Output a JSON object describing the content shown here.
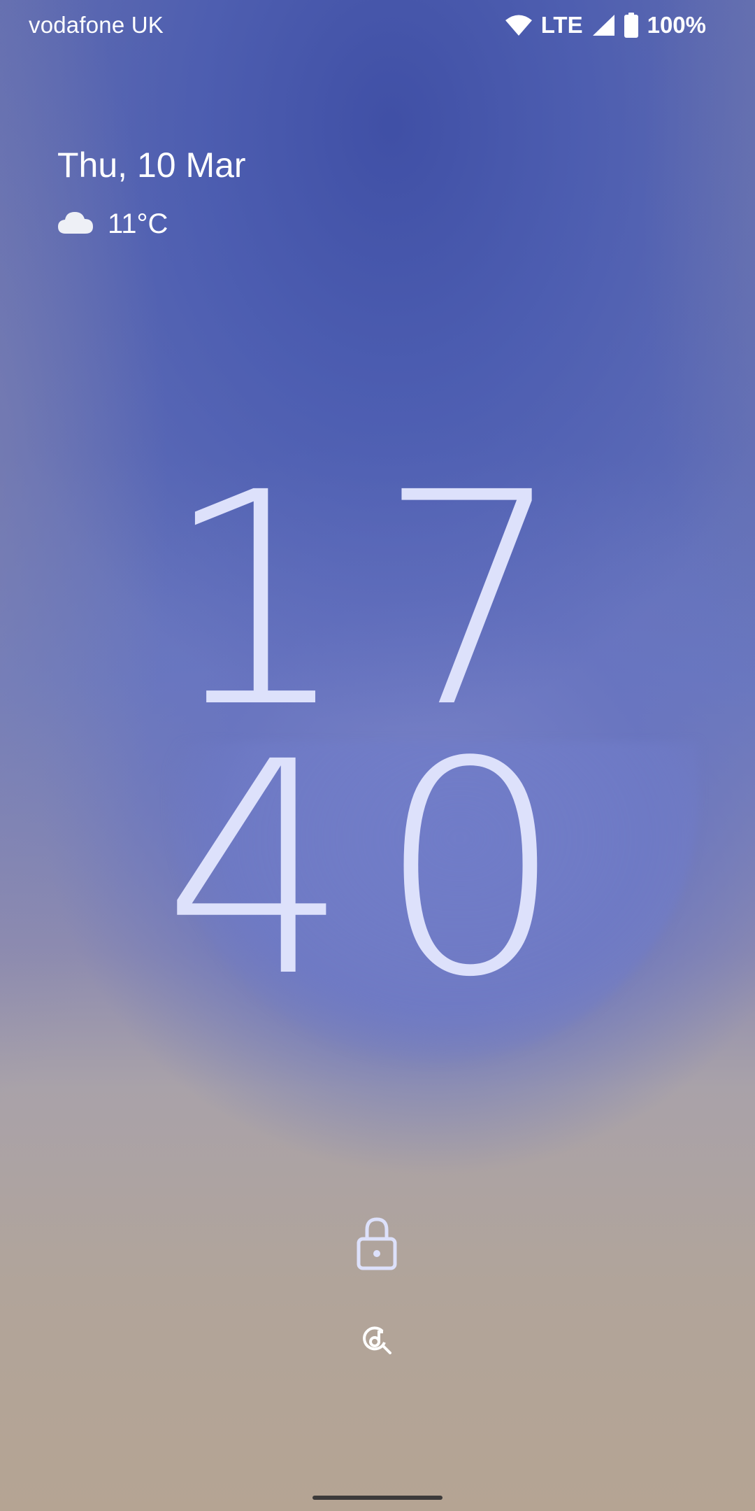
{
  "status_bar": {
    "carrier": "vodafone UK",
    "network_type": "LTE",
    "battery_percent": "100%",
    "icons": [
      "wifi-icon",
      "cell-signal-icon",
      "battery-icon"
    ]
  },
  "lockscreen": {
    "date": "Thu, 10 Mar",
    "weather": {
      "icon": "cloud-icon",
      "temperature": "11°C"
    },
    "clock": {
      "hours": "17",
      "minutes": "40"
    },
    "lock_icon": "lock-icon",
    "shortcut_icon": "now-playing-search-icon"
  },
  "colors": {
    "clock_text": "#dde1fb",
    "wallpaper_blue": "#5f6db8",
    "wallpaper_sand": "#b5a493"
  }
}
